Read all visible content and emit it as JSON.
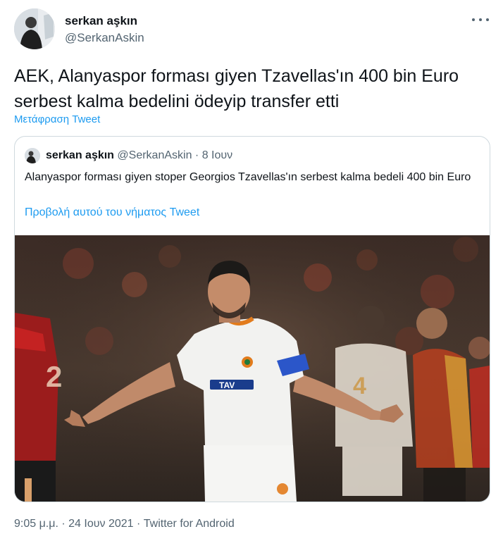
{
  "tweet": {
    "display_name": "serkan aşkın",
    "handle": "@SerkanAskin",
    "text": "AEK, Alanyaspor forması giyen Tzavellas'ın 400 bin Euro serbest kalma bedelini ödeyip transfer etti",
    "translate_label": "Μετάφραση Tweet",
    "timestamp": "9:05 μ.μ.",
    "date": "24 Ιουν 2021",
    "source": "Twitter for Android",
    "separator": "·"
  },
  "quoted": {
    "display_name": "serkan aşkın",
    "handle": "@SerkanAskin",
    "date": "8 Ιουν",
    "separator": "·",
    "text": "Alanyaspor forması giyen stoper Georgios Tzavellas'ın serbest kalma bedeli 400 bin Euro",
    "thread_link": "Προβολή αυτού του νήματος Tweet",
    "image": {
      "jersey_number_opponent": "2",
      "jersey_number_teammate": "4",
      "sponsor_text": "TAV"
    }
  },
  "icons": {
    "more": "more-horizontal-icon"
  },
  "colors": {
    "link": "#1d9bf0",
    "secondary_text": "#536471",
    "border": "#cfd9de"
  }
}
